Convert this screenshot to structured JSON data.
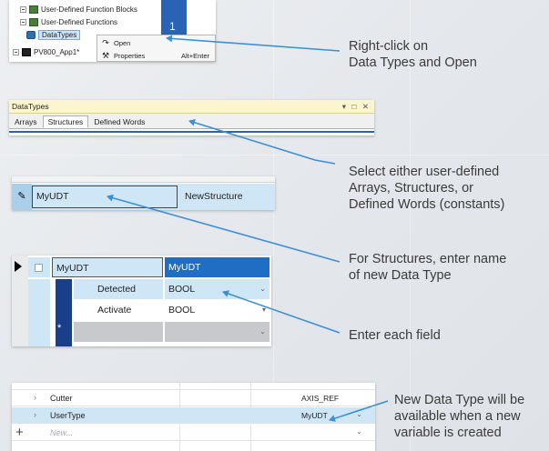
{
  "screenshot1": {
    "tree": [
      "User-Defined Function Blocks",
      "User-Defined Functions",
      "DataTypes",
      "PV800_App1*"
    ],
    "panel_number": "1",
    "context_menu": [
      {
        "icon": "open-icon",
        "glyph": "↷",
        "label": "Open",
        "shortcut": ""
      },
      {
        "icon": "wrench-icon",
        "glyph": "⚒",
        "label": "Properties",
        "shortcut": "Alt+Enter"
      }
    ]
  },
  "screenshot2": {
    "title": "DataTypes",
    "window_controls": "▾ □ ✕",
    "tabs": [
      "Arrays",
      "Structures",
      "Defined Words"
    ],
    "active_tab": "Structures"
  },
  "screenshot3": {
    "name": "MyUDT",
    "type": "NewStructure"
  },
  "screenshot4": {
    "header": {
      "name": "MyUDT",
      "type": "MyUDT"
    },
    "fields": [
      {
        "name": "Detected",
        "type": "BOOL"
      },
      {
        "name": "Activate",
        "type": "BOOL"
      }
    ],
    "new_row_marker": "*"
  },
  "screenshot5": {
    "rows": [
      {
        "name": "Cutter",
        "type": "AXIS_REF",
        "selected": false
      },
      {
        "name": "UserType",
        "type": "MyUDT",
        "selected": true
      },
      {
        "name": "New...",
        "type": "",
        "selected": false
      }
    ],
    "add_glyph": "+"
  },
  "notes": {
    "n1": [
      "Right-click on",
      "Data Types and Open"
    ],
    "n2": [
      "Select either user-defined",
      "Arrays, Structures, or",
      "Defined Words (constants)"
    ],
    "n3": [
      "For Structures, enter name",
      "of new Data Type"
    ],
    "n4": [
      "Enter each field"
    ],
    "n5": [
      "New Data Type will be",
      "available when a new",
      "variable is created"
    ]
  },
  "colors": {
    "arrow": "#3b8fd6",
    "accent_blue": "#1f6ec4",
    "selection": "#cfe6f6"
  }
}
